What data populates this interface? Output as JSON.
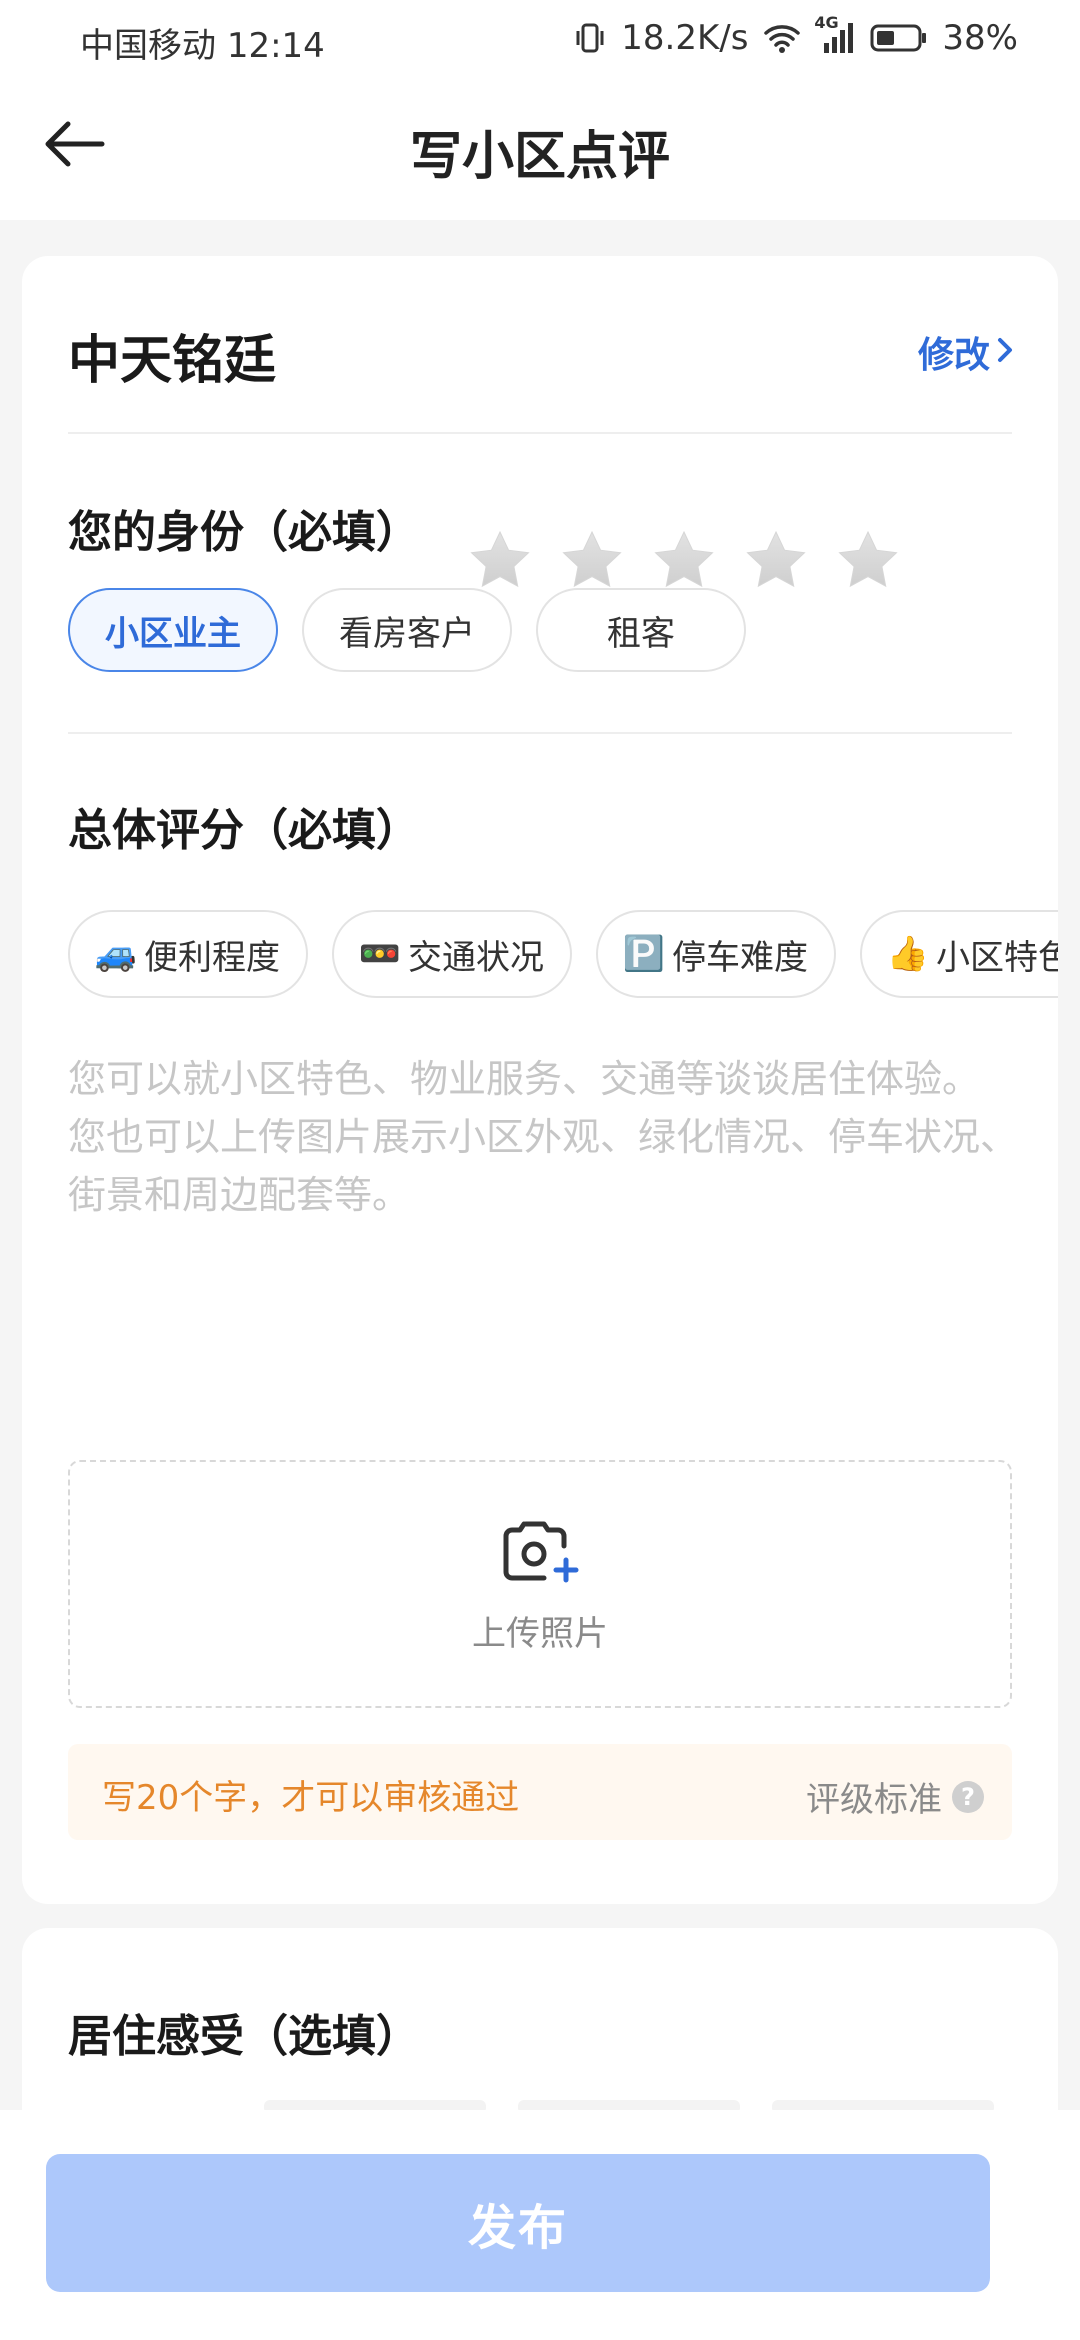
{
  "status_bar": {
    "carrier": "中国移动",
    "time": "12:14",
    "speed": "18.2K/s",
    "network": "4G",
    "battery": "38%"
  },
  "header": {
    "title": "写小区点评"
  },
  "community": {
    "name": "中天铭廷",
    "edit_label": "修改"
  },
  "identity": {
    "title": "您的身份（必填）",
    "options": [
      {
        "label": "小区业主",
        "selected": true
      },
      {
        "label": "看房客户",
        "selected": false
      },
      {
        "label": "租客",
        "selected": false
      }
    ]
  },
  "rating": {
    "title": "总体评分（必填）",
    "max_stars": 5,
    "value": 0
  },
  "tags": [
    {
      "emoji": "🚙",
      "label": "便利程度"
    },
    {
      "emoji": "🚥",
      "label": "交通状况"
    },
    {
      "emoji": "🅿️",
      "label": "停车难度"
    },
    {
      "emoji": "👍",
      "label": "小区特色"
    }
  ],
  "review_input": {
    "placeholder": "您可以就小区特色、物业服务、交通等谈谈居住体验。\n您也可以上传图片展示小区外观、绿化情况、停车状况、街景和周边配套等。"
  },
  "upload": {
    "label": "上传照片"
  },
  "notice": {
    "message": "写20个字，才可以审核通过",
    "standard_label": "评级标准",
    "help_icon": "?"
  },
  "living": {
    "title": "居住感受（选填）"
  },
  "footer": {
    "publish_label": "发布"
  },
  "colors": {
    "accent": "#2f6bd8",
    "notice_text": "#e5872b",
    "publish_disabled": "#adc8fb"
  }
}
